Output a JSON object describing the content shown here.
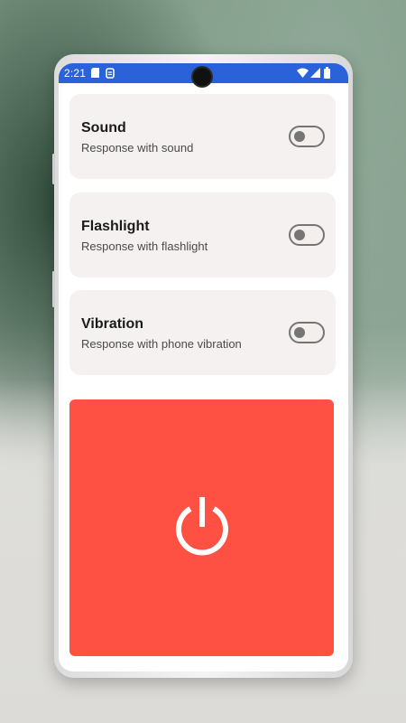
{
  "status_bar": {
    "time": "2:21",
    "left_icons": [
      "sim-card-icon",
      "notification-icon"
    ],
    "right_icons": [
      "wifi-icon",
      "cellular-signal-icon",
      "battery-icon"
    ],
    "color": "#2962d9"
  },
  "settings": [
    {
      "title": "Sound",
      "subtitle": "Response with sound",
      "enabled": false
    },
    {
      "title": "Flashlight",
      "subtitle": "Response with flashlight",
      "enabled": false
    },
    {
      "title": "Vibration",
      "subtitle": "Response with phone vibration",
      "enabled": false
    }
  ],
  "power_button": {
    "icon": "power-icon",
    "color": "#fe5143"
  }
}
